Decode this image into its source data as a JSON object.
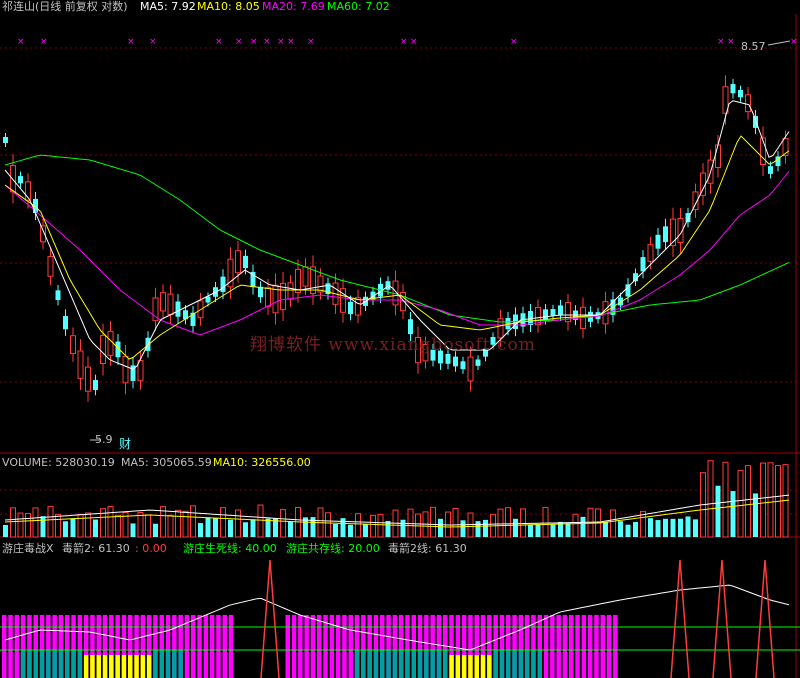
{
  "header": {
    "stock": "祁连山(日线 前复权 对数)",
    "ma5": "MA5: 7.92",
    "ma10": "MA10: 8.05",
    "ma20": "MA20: 7.69",
    "ma60": "MA60: 7.02"
  },
  "price_labels": {
    "high": "8.57",
    "low": "5.9",
    "low_marker": "财"
  },
  "watermark": "翔博软件  www.xiangbosoft.com",
  "volume": {
    "label": "VOLUME: 528030.19",
    "ma5": "MA5: 305065.59",
    "ma10": "MA10: 326556.00"
  },
  "indicator": {
    "name": "游庄毒战X",
    "arrow2": "毒箭2: 61.30",
    "zero": ": 0.00",
    "life_line": "游庄生死线: 40.00",
    "survive_line": "游庄共存线: 20.00",
    "arrow2_line": "毒箭2线: 61.30"
  },
  "colors": {
    "up": "#ff3c3c",
    "down": "#54ffff",
    "ma5": "#ffffff",
    "ma10": "#ffff00",
    "ma20": "#ff00ff",
    "ma60": "#00ff00",
    "grid": "#800000",
    "label": "#c0c0c0",
    "mark": "#ff00ff",
    "bar_yellow": "#ffff00",
    "bar_teal": "#00a0a0",
    "bar_green": "#00ff00"
  }
}
